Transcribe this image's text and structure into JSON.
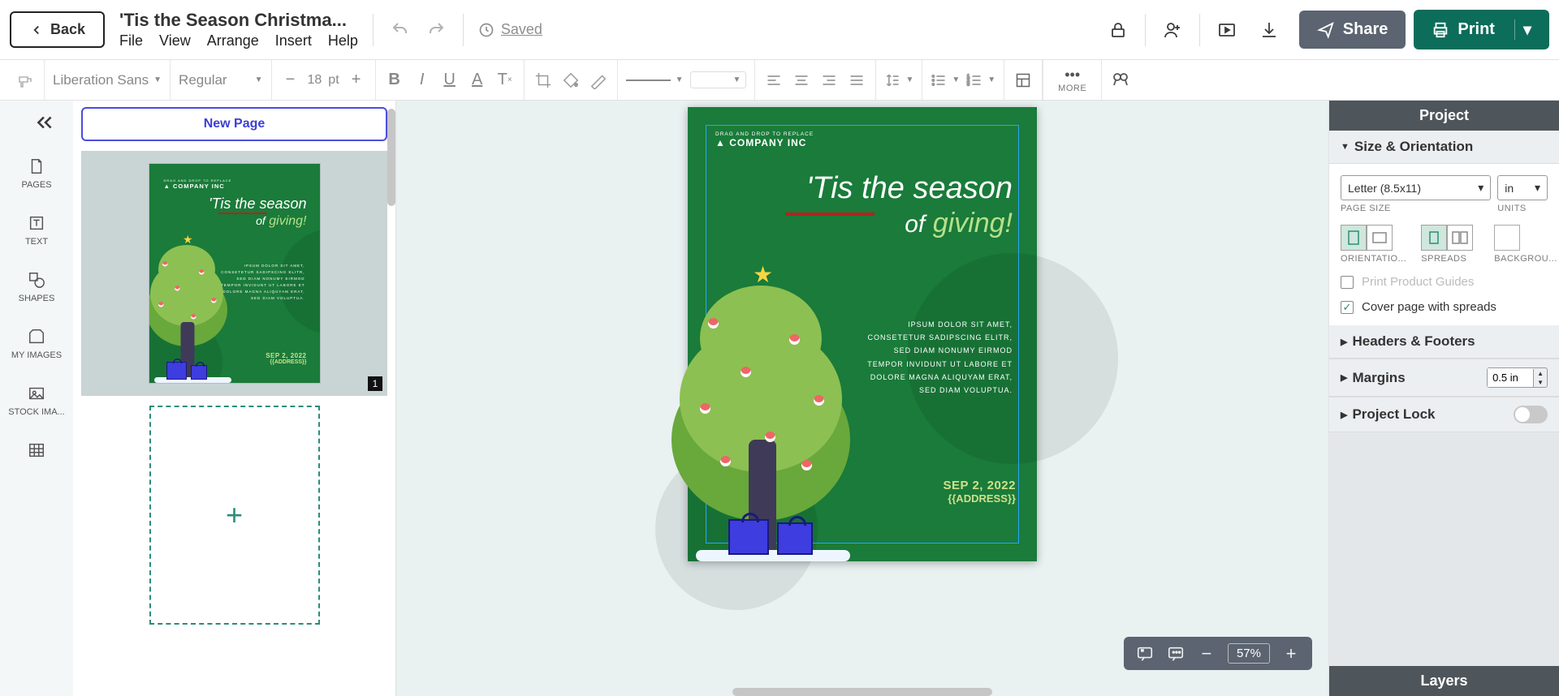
{
  "header": {
    "back": "Back",
    "title": "'Tis the Season Christma...",
    "menu": [
      "File",
      "View",
      "Arrange",
      "Insert",
      "Help"
    ],
    "saved": "Saved",
    "share": "Share",
    "print": "Print"
  },
  "fmt": {
    "font": "Liberation Sans",
    "weight": "Regular",
    "size": "18",
    "unit": "pt",
    "more": "MORE"
  },
  "rail": {
    "pages": "PAGES",
    "text": "TEXT",
    "shapes": "SHAPES",
    "myimages": "MY IMAGES",
    "stock": "STOCK IMA..."
  },
  "pages": {
    "new": "New Page",
    "num1": "1"
  },
  "canvas": {
    "company_small": "DRAG AND DROP TO REPLACE",
    "company": "COMPANY INC",
    "headline1": "'Tis the season",
    "headline_of": "of",
    "headline_giving": "giving!",
    "body": "IPSUM DOLOR SIT AMET, CONSETETUR SADIPSCING ELITR, SED DIAM NONUMY EIRMOD TEMPOR INVIDUNT UT LABORE ET DOLORE MAGNA ALIQUYAM ERAT, SED DIAM VOLUPTUA.",
    "date": "SEP 2, 2022",
    "address": "{{ADDRESS}}"
  },
  "zoom": {
    "value": "57%"
  },
  "props": {
    "project": "Project",
    "size_section": "Size & Orientation",
    "page_size_val": "Letter (8.5x11)",
    "page_size_lbl": "PAGE SIZE",
    "units_val": "in",
    "units_lbl": "UNITS",
    "orient_lbl": "ORIENTATIO...",
    "spreads_lbl": "SPREADS",
    "bg_lbl": "BACKGROU...",
    "print_guides": "Print Product Guides",
    "cover_spreads": "Cover page with spreads",
    "headers_section": "Headers & Footers",
    "margins_section": "Margins",
    "margins_val": "0.5 in",
    "lock_section": "Project Lock",
    "layers": "Layers"
  }
}
